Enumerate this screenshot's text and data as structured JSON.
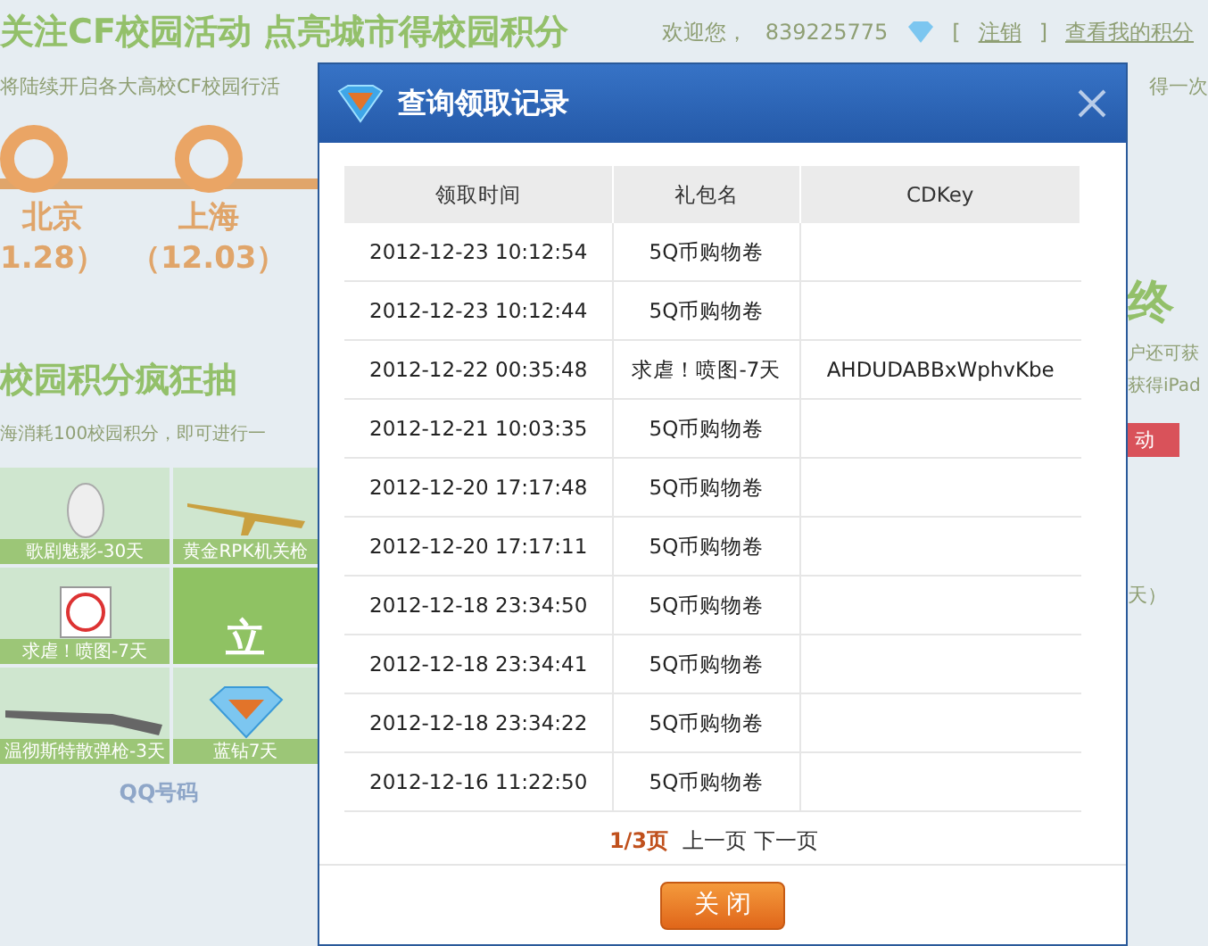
{
  "page": {
    "header_title": "关注CF校园活动 点亮城市得校园积分",
    "welcome": "欢迎您，",
    "user_id": "839225775",
    "logout_open": "[",
    "logout": "注销",
    "logout_close": "]",
    "my_points": "查看我的积分",
    "intro_left": "将陆续开启各大高校CF校园行活",
    "intro_right": "得一次",
    "cities": [
      {
        "name": "北京",
        "date": "1.28）"
      },
      {
        "name": "上海",
        "date": "（12.03）"
      }
    ],
    "lottery_title": "校园积分疯狂抽",
    "lottery_desc": "海消耗100校园积分，即可进行一",
    "prizes": [
      {
        "kind": "mask",
        "label": "歌剧魅影-30天"
      },
      {
        "kind": "gun",
        "label": "黄金RPK机关枪"
      },
      {
        "kind": "sticker",
        "label": "求虐！喷图-7天"
      },
      {
        "kind": "rifle",
        "label": "温彻斯特散弹枪-3天"
      },
      {
        "kind": "diamond",
        "label": "蓝钻7天"
      }
    ],
    "draw_button": "立",
    "qq_label": "QQ号码",
    "right": {
      "heading": "终",
      "line1": "户还可获",
      "line2": "获得iPad",
      "tag": "动",
      "note": "天）"
    }
  },
  "dialog": {
    "title": "查询领取记录",
    "columns": [
      "领取时间",
      "礼包名",
      "CDKey"
    ],
    "rows": [
      {
        "time": "2012-12-23 10:12:54",
        "gift": "5Q币购物卷",
        "cdkey": ""
      },
      {
        "time": "2012-12-23 10:12:44",
        "gift": "5Q币购物卷",
        "cdkey": ""
      },
      {
        "time": "2012-12-22 00:35:48",
        "gift": "求虐！喷图-7天",
        "cdkey": "AHDUDABBxWphvKbe"
      },
      {
        "time": "2012-12-21 10:03:35",
        "gift": "5Q币购物卷",
        "cdkey": ""
      },
      {
        "time": "2012-12-20 17:17:48",
        "gift": "5Q币购物卷",
        "cdkey": ""
      },
      {
        "time": "2012-12-20 17:17:11",
        "gift": "5Q币购物卷",
        "cdkey": ""
      },
      {
        "time": "2012-12-18 23:34:50",
        "gift": "5Q币购物卷",
        "cdkey": ""
      },
      {
        "time": "2012-12-18 23:34:41",
        "gift": "5Q币购物卷",
        "cdkey": ""
      },
      {
        "time": "2012-12-18 23:34:22",
        "gift": "5Q币购物卷",
        "cdkey": ""
      },
      {
        "time": "2012-12-16 11:22:50",
        "gift": "5Q币购物卷",
        "cdkey": ""
      }
    ],
    "pagination": {
      "page": "1/3页",
      "prev": "上一页",
      "next": "下一页"
    },
    "close_button": "关 闭"
  }
}
